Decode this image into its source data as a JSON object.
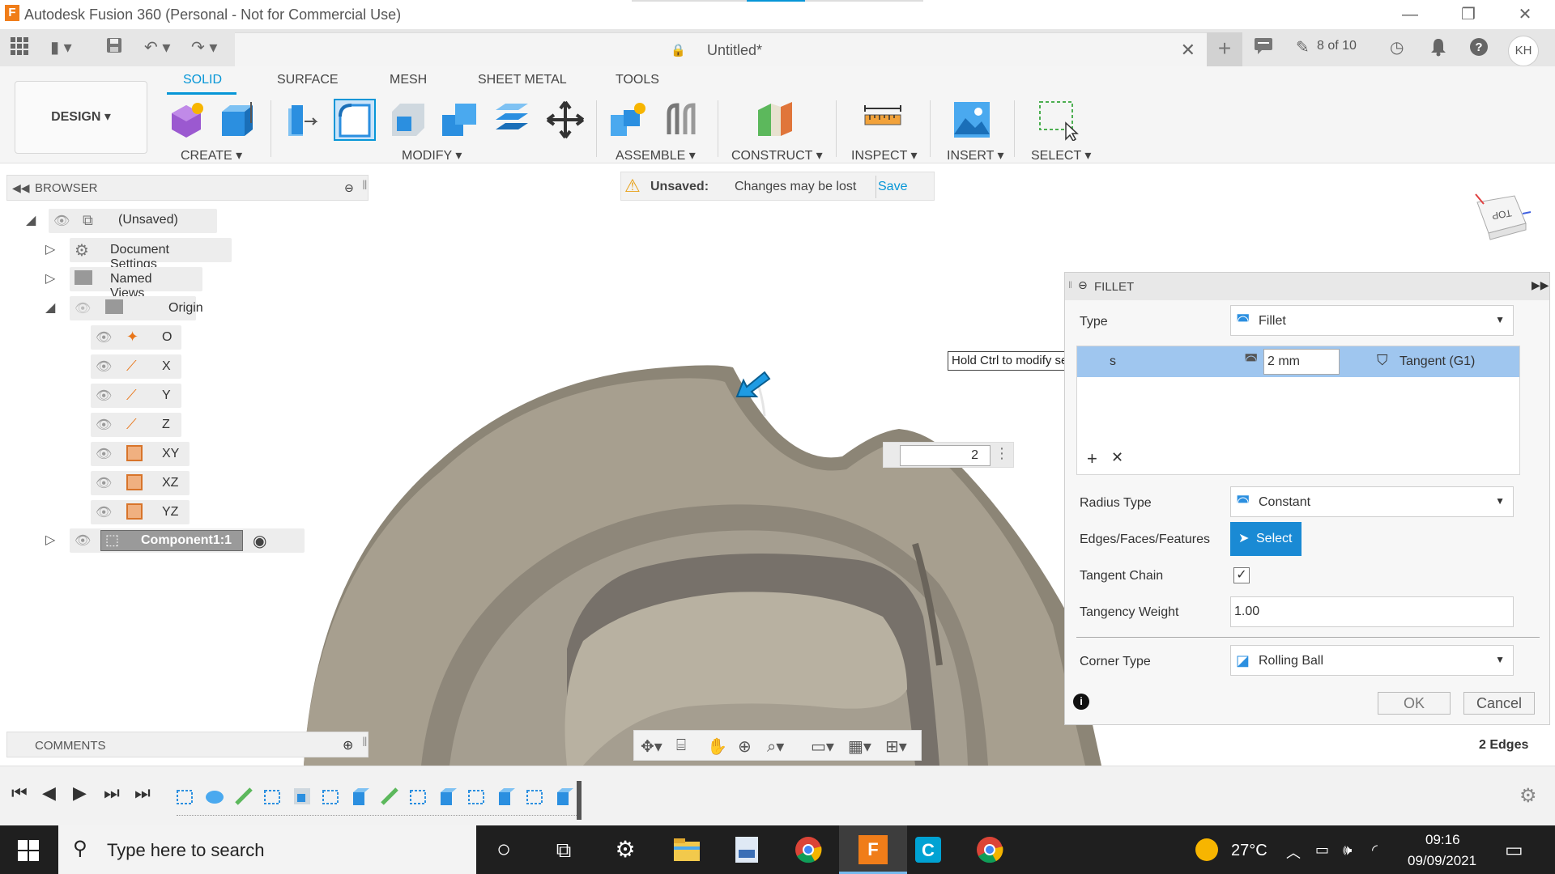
{
  "window": {
    "title": "Autodesk Fusion 360 (Personal - Not for Commercial Use)",
    "logo_letter": "F"
  },
  "quickbar": {
    "doc_title": "Untitled*",
    "job_status": "8 of 10",
    "user_initials": "KH"
  },
  "ribbon": {
    "workspace": "DESIGN ▾",
    "tabs": [
      "SOLID",
      "SURFACE",
      "MESH",
      "SHEET METAL",
      "TOOLS"
    ],
    "groups": [
      "CREATE ▾",
      "MODIFY ▾",
      "ASSEMBLE ▾",
      "CONSTRUCT ▾",
      "INSPECT ▾",
      "INSERT ▾",
      "SELECT ▾"
    ]
  },
  "browser": {
    "title": "BROWSER",
    "root": "(Unsaved)",
    "items": [
      "Document Settings",
      "Named Views",
      "Origin"
    ],
    "origin_items": [
      "O",
      "X",
      "Y",
      "Z",
      "XY",
      "XZ",
      "YZ"
    ],
    "component": "Component1:1"
  },
  "unsaved": {
    "label": "Unsaved:",
    "message": "Changes may be lost",
    "save": "Save"
  },
  "tooltip": "Hold Ctrl to modify selection",
  "inline_input": {
    "value": "2"
  },
  "fillet": {
    "title": "FILLET",
    "type_label": "Type",
    "type_value": "Fillet",
    "row_label": "s",
    "radius_value": "2 mm",
    "continuity": "Tangent (G1)",
    "radius_type_label": "Radius Type",
    "radius_type_value": "Constant",
    "edges_label": "Edges/Faces/Features",
    "select_btn": "Select",
    "tangent_chain_label": "Tangent Chain",
    "tangent_chain_checked": true,
    "tangency_weight_label": "Tangency Weight",
    "tangency_weight_value": "1.00",
    "corner_type_label": "Corner Type",
    "corner_type_value": "Rolling Ball",
    "ok": "OK",
    "cancel": "Cancel"
  },
  "comments": {
    "title": "COMMENTS"
  },
  "selection_count": "2 Edges",
  "viewcube": {
    "face": "TOP"
  },
  "taskbar": {
    "search_placeholder": "Type here to search",
    "temperature": "27°C",
    "time": "09:16",
    "date": "09/09/2021"
  },
  "colors": {
    "accent": "#0696d7",
    "select_button": "#1a8ad4",
    "selected_row": "#9fc6ef",
    "model": "#8c8576",
    "taskbar": "#1f1f1f"
  }
}
